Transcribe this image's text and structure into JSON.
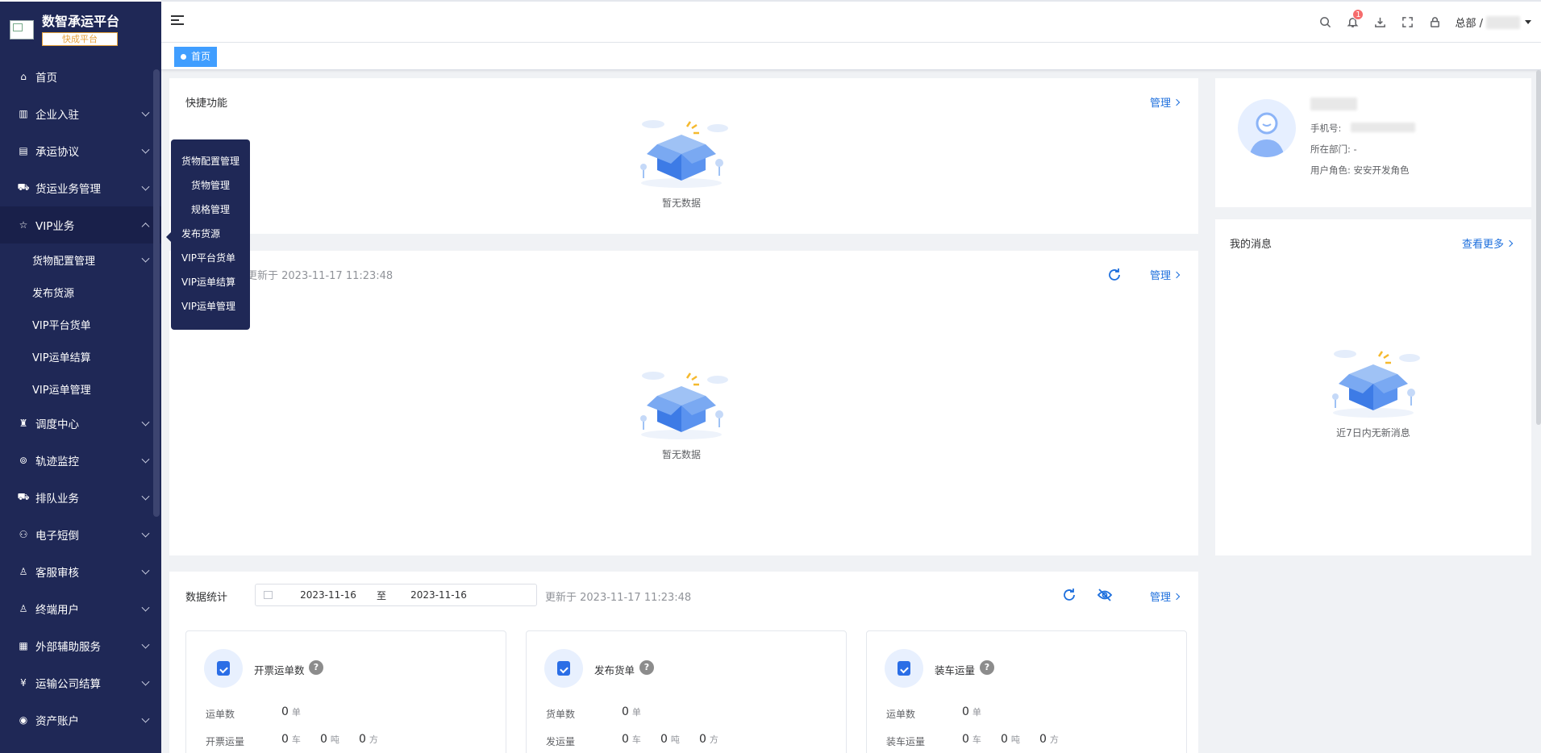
{
  "brand": {
    "title": "数智承运平台",
    "badge": "快成平台"
  },
  "sidebar": {
    "items": [
      {
        "label": "首页",
        "icon": "home-icon"
      },
      {
        "label": "企业入驻",
        "icon": "building-icon"
      },
      {
        "label": "承运协议",
        "icon": "contract-icon"
      },
      {
        "label": "货运业务管理",
        "icon": "truck-icon"
      },
      {
        "label": "VIP业务",
        "icon": "star-icon"
      }
    ],
    "vip_sub": [
      "货物配置管理",
      "发布货源",
      "VIP平台货单",
      "VIP运单结算",
      "VIP运单管理"
    ],
    "items_after": [
      {
        "label": "调度中心",
        "icon": "dispatch-icon"
      },
      {
        "label": "轨迹监控",
        "icon": "track-icon"
      },
      {
        "label": "排队业务",
        "icon": "queue-icon"
      },
      {
        "label": "电子短倒",
        "icon": "transfer-icon"
      },
      {
        "label": "客服审核",
        "icon": "service-icon"
      },
      {
        "label": "终端用户",
        "icon": "user-icon"
      },
      {
        "label": "外部辅助服务",
        "icon": "grid-icon"
      },
      {
        "label": "运输公司结算",
        "icon": "yen-icon"
      },
      {
        "label": "资产账户",
        "icon": "asset-icon"
      }
    ]
  },
  "flyout": [
    "货物配置管理",
    "货物管理",
    "规格管理",
    "发布货源",
    "VIP平台货单",
    "VIP运单结算",
    "VIP运单管理"
  ],
  "topbar": {
    "notif_count": "1",
    "user": "总部 /"
  },
  "tags": {
    "home": "首页"
  },
  "quick": {
    "title": "快捷功能",
    "manage": "管理",
    "empty": "暂无数据"
  },
  "panel2": {
    "updated": "更新于 2023-11-17 11:23:48",
    "manage": "管理",
    "empty": "暂无数据"
  },
  "profile": {
    "phone_label": "手机号:",
    "dept": "所在部门: -",
    "role": "用户角色: 安安开发角色"
  },
  "messages": {
    "title": "我的消息",
    "more": "查看更多",
    "empty": "近7日内无新消息"
  },
  "stats": {
    "title": "数据统计",
    "date_from": "2023-11-16",
    "date_sep": "至",
    "date_to": "2023-11-16",
    "updated": "更新于 2023-11-17 11:23:48",
    "manage": "管理",
    "cards": [
      {
        "name": "开票运单数",
        "row1_label": "运单数",
        "row1_value": "0",
        "row1_unit": "单",
        "row2_label": "开票运量",
        "v1": "0",
        "u1": "车",
        "v2": "0",
        "u2": "吨",
        "v3": "0",
        "u3": "方"
      },
      {
        "name": "发布货单",
        "row1_label": "货单数",
        "row1_value": "0",
        "row1_unit": "单",
        "row2_label": "发运量",
        "v1": "0",
        "u1": "车",
        "v2": "0",
        "u2": "吨",
        "v3": "0",
        "u3": "方"
      },
      {
        "name": "装车运量",
        "row1_label": "运单数",
        "row1_value": "0",
        "row1_unit": "单",
        "row2_label": "装车运量",
        "v1": "0",
        "u1": "车",
        "v2": "0",
        "u2": "吨",
        "v3": "0",
        "u3": "方"
      }
    ]
  },
  "colors": {
    "sidebar": "#1f2856",
    "accent": "#1d6fdd",
    "tag": "#409eff"
  }
}
